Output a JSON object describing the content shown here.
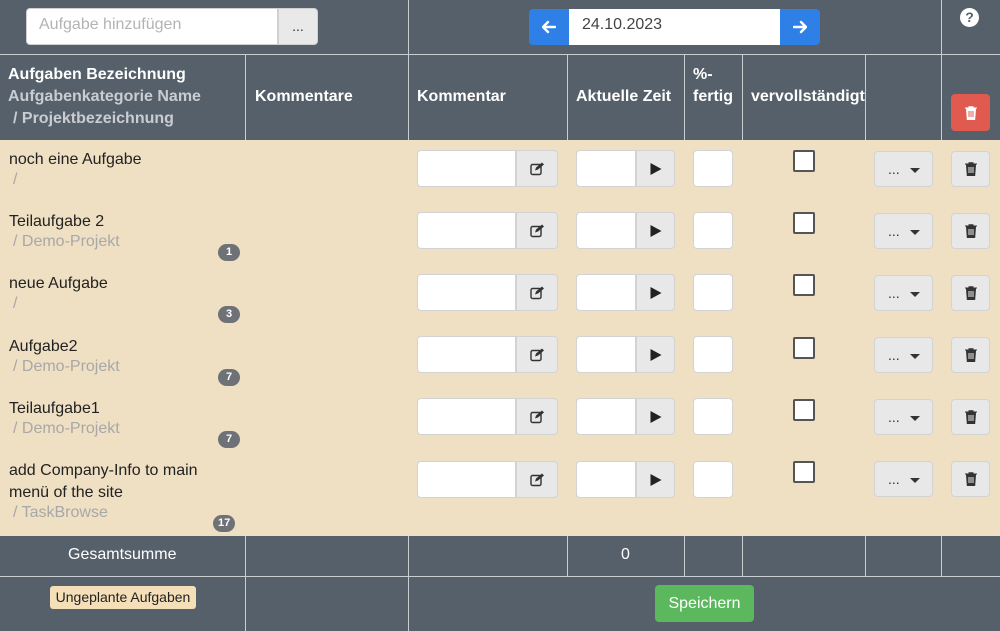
{
  "topbar": {
    "task_placeholder": "Aufgabe hinzufügen",
    "task_more_label": "...",
    "date_value": "24.10.2023",
    "help_label": "?"
  },
  "header": {
    "col_name": "Aufgaben Bezeichnung",
    "col_category": "Aufgabenkategorie Name",
    "col_project": "/ Projektbezeichnung",
    "col_comments": "Kommentare",
    "col_comment": "Kommentar",
    "col_time": "Aktuelle Zeit",
    "col_pct_line1": "%-",
    "col_pct_line2": "fertig",
    "col_done": "vervollständigt"
  },
  "rows": [
    {
      "name": "noch eine Aufgabe",
      "project": "/",
      "badge": ""
    },
    {
      "name": "Teilaufgabe 2",
      "project": "/ Demo-Projekt",
      "badge": "1"
    },
    {
      "name": "neue Aufgabe",
      "project": "/",
      "badge": "3"
    },
    {
      "name": "Aufgabe2",
      "project": "/ Demo-Projekt",
      "badge": "7"
    },
    {
      "name": "Teilaufgabe1",
      "project": "/ Demo-Projekt",
      "badge": "7"
    },
    {
      "name_line1": "add Company-Info to main",
      "name_line2": "menü of the site",
      "project": "/ TaskBrowse",
      "badge": "17"
    }
  ],
  "row_menu_label": "...",
  "footer": {
    "total_label": "Gesamtsumme",
    "total_time": "0",
    "unplanned_label": "Ungeplante Aufgaben",
    "save_label": "Speichern"
  }
}
